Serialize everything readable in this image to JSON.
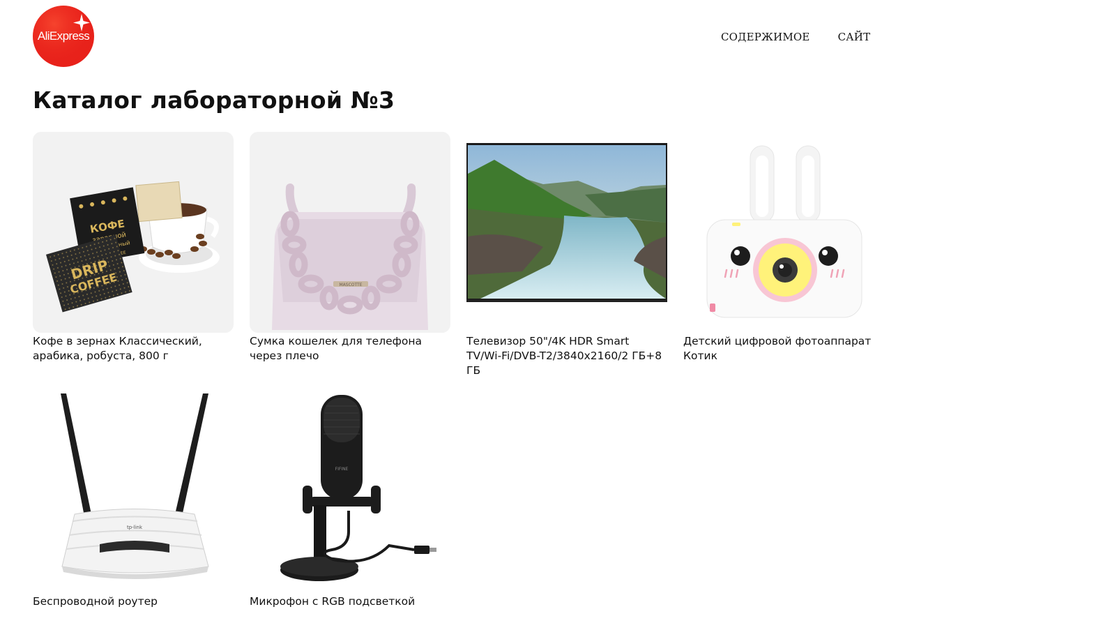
{
  "logo": {
    "text": "AliExpress",
    "color": "#e62e22"
  },
  "nav": {
    "items": [
      "СОДЕРЖИМОЕ",
      "САЙТ"
    ]
  },
  "page": {
    "title": "Каталог лабораторной №3"
  },
  "products": [
    {
      "name": "Кофе в зернах Классический, арабика, робуста, 800 г",
      "image": "coffee-pack-image",
      "pack_text": [
        "КОФЕ",
        "заварной",
        "натуральный",
        "DRIP COFFEE",
        "DRIP",
        "COFFEE"
      ]
    },
    {
      "name": "Сумка кошелек для телефона через плечо",
      "image": "lilac-handbag-image",
      "brand": "MASCOTTE"
    },
    {
      "name": "Телевизор 50\"/4K HDR Smart TV/Wi-Fi/DVB-T2/3840x2160/2 ГБ+8 ГБ",
      "image": "tv-landscape-image"
    },
    {
      "name": "Детский цифровой фотоаппарат Котик",
      "image": "bunny-camera-image"
    },
    {
      "name": "Беспроводной роутер",
      "image": "wireless-router-image",
      "brand": "tp-link"
    },
    {
      "name": "Микрофон с RGB подсветкой",
      "image": "usb-microphone-image",
      "brand": "FIFINE"
    }
  ]
}
